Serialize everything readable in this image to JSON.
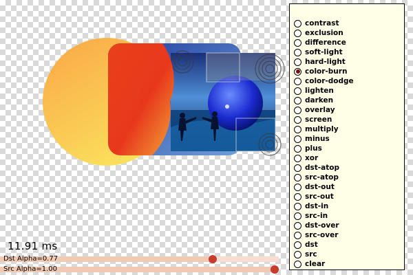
{
  "timing": {
    "text": "11.91 ms"
  },
  "sliders": {
    "dst": {
      "label": "Dst Alpha=0.77",
      "value": 0.77
    },
    "src": {
      "label": "Src Alpha=1.00",
      "value": 1.0
    }
  },
  "modes": {
    "selected": "color-burn",
    "items": [
      "contrast",
      "exclusion",
      "difference",
      "soft-light",
      "hard-light",
      "color-burn",
      "color-dodge",
      "lighten",
      "darken",
      "overlay",
      "screen",
      "multiply",
      "minus",
      "plus",
      "xor",
      "dst-atop",
      "src-atop",
      "dst-out",
      "src-out",
      "dst-in",
      "src-in",
      "dst-over",
      "src-over",
      "dst",
      "src",
      "clear"
    ]
  },
  "colors": {
    "accent_knob": "#c83c2e",
    "radio_selected": "#7a0e0e",
    "panel_bg": "#ffffe8"
  }
}
